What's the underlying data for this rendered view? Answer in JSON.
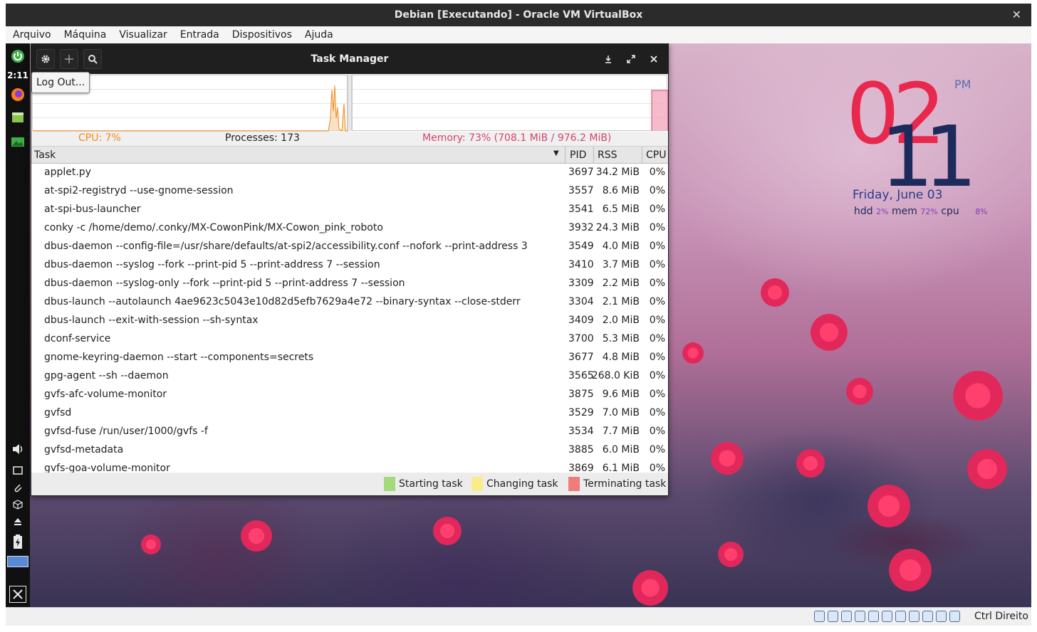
{
  "vbox": {
    "title": "Debian [Executando] - Oracle VM VirtualBox",
    "close_glyph": "✕",
    "menus": [
      "Arquivo",
      "Máquina",
      "Visualizar",
      "Entrada",
      "Dispositivos",
      "Ajuda"
    ],
    "host_key": "Ctrl Direito"
  },
  "panel": {
    "clock": "2:11",
    "tooltip": "Log Out..."
  },
  "conky": {
    "hour": "02",
    "minute": "11",
    "ampm": "PM",
    "date": "Friday, June 03",
    "hdd_label": "hdd",
    "hdd_value": "2%",
    "mem_label": "mem",
    "mem_value": "72%",
    "cpu_label": "cpu",
    "cpu_value": "8%"
  },
  "taskmanager": {
    "title": "Task Manager",
    "summary": {
      "cpu": "CPU: 7%",
      "processes": "Processes: 173",
      "memory": "Memory: 73% (708.1 MiB / 976.2 MiB)"
    },
    "columns": {
      "task": "Task",
      "pid": "PID",
      "rss": "RSS",
      "cpu": "CPU"
    },
    "rows": [
      {
        "task": "applet.py",
        "pid": "3697",
        "rss": "34.2 MiB",
        "cpu": "0%"
      },
      {
        "task": "at-spi2-registryd --use-gnome-session",
        "pid": "3557",
        "rss": "8.6 MiB",
        "cpu": "0%"
      },
      {
        "task": "at-spi-bus-launcher",
        "pid": "3541",
        "rss": "6.5 MiB",
        "cpu": "0%"
      },
      {
        "task": "conky -c /home/demo/.conky/MX-CowonPink/MX-Cowon_pink_roboto",
        "pid": "3932",
        "rss": "24.3 MiB",
        "cpu": "0%"
      },
      {
        "task": "dbus-daemon --config-file=/usr/share/defaults/at-spi2/accessibility.conf --nofork --print-address 3",
        "pid": "3549",
        "rss": "4.0 MiB",
        "cpu": "0%"
      },
      {
        "task": "dbus-daemon --syslog --fork --print-pid 5 --print-address 7 --session",
        "pid": "3410",
        "rss": "3.7 MiB",
        "cpu": "0%"
      },
      {
        "task": "dbus-daemon --syslog-only --fork --print-pid 5 --print-address 7 --session",
        "pid": "3309",
        "rss": "2.2 MiB",
        "cpu": "0%"
      },
      {
        "task": "dbus-launch --autolaunch 4ae9623c5043e10d82d5efb7629a4e72 --binary-syntax --close-stderr",
        "pid": "3304",
        "rss": "2.1 MiB",
        "cpu": "0%"
      },
      {
        "task": "dbus-launch --exit-with-session --sh-syntax",
        "pid": "3409",
        "rss": "2.0 MiB",
        "cpu": "0%"
      },
      {
        "task": "dconf-service",
        "pid": "3700",
        "rss": "5.3 MiB",
        "cpu": "0%"
      },
      {
        "task": "gnome-keyring-daemon --start --components=secrets",
        "pid": "3677",
        "rss": "4.8 MiB",
        "cpu": "0%"
      },
      {
        "task": "gpg-agent --sh --daemon",
        "pid": "3565",
        "rss": "268.0 KiB",
        "cpu": "0%"
      },
      {
        "task": "gvfs-afc-volume-monitor",
        "pid": "3875",
        "rss": "9.6 MiB",
        "cpu": "0%"
      },
      {
        "task": "gvfsd",
        "pid": "3529",
        "rss": "7.0 MiB",
        "cpu": "0%"
      },
      {
        "task": "gvfsd-fuse /run/user/1000/gvfs -f",
        "pid": "3534",
        "rss": "7.7 MiB",
        "cpu": "0%"
      },
      {
        "task": "gvfsd-metadata",
        "pid": "3885",
        "rss": "6.0 MiB",
        "cpu": "0%"
      },
      {
        "task": "gvfs-goa-volume-monitor",
        "pid": "3869",
        "rss": "6.1 MiB",
        "cpu": "0%"
      }
    ],
    "legend": {
      "starting": "Starting task",
      "changing": "Changing task",
      "terminating": "Terminating task"
    },
    "colors": {
      "cpu_graph": "#f08a1a",
      "memory_graph": "#d4456c",
      "starting": "#a6d97c",
      "changing": "#fbec8b",
      "terminating": "#ef7b7b"
    }
  },
  "icons": {
    "toolbar": [
      "gear-icon",
      "move-icon",
      "search-icon"
    ],
    "window": [
      "download-icon",
      "fullscreen-icon",
      "close-icon"
    ],
    "panel": [
      "logout-icon",
      "firefox-icon",
      "file-manager-icon",
      "image-viewer-icon",
      "volume-icon",
      "window-icon",
      "paperclip-icon",
      "package-icon",
      "eject-icon",
      "battery-icon",
      "mx-logo-icon"
    ]
  }
}
